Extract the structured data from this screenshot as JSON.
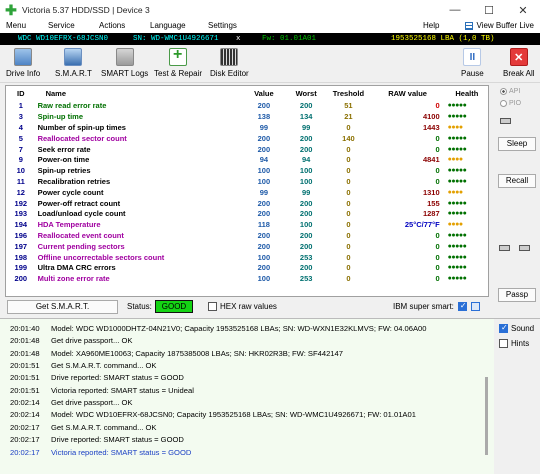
{
  "window": {
    "title": "Victoria 5.37 HDD/SSD | Device 3",
    "minimize": "—",
    "maximize": "☐",
    "close": "✕"
  },
  "menu": {
    "items": [
      "Menu",
      "Service",
      "Actions",
      "Language",
      "Settings"
    ],
    "help": "Help",
    "view_buffer": "View Buffer Live"
  },
  "device_bar": {
    "model": "WDC WD10EFRX-68JCSN0",
    "serial": "SN: WD-WMC1U4926671",
    "close": "x",
    "firmware": "Fw: 01.01A01",
    "capacity": "1953525168 LBA (1,0 TB)",
    "colors": {
      "model": "#00ffff",
      "serial": "#00ffff",
      "firmware": "#00c000",
      "capacity": "#ffff00"
    }
  },
  "toolbar": {
    "drive_info": "Drive Info",
    "smart": "S.M.A.R.T",
    "smart_logs": "SMART Logs",
    "test_repair": "Test & Repair",
    "disk_editor": "Disk Editor",
    "pause": "Pause",
    "break_all": "Break All",
    "pause_glyph": "II",
    "break_glyph": "✕"
  },
  "smart": {
    "headers": [
      "ID",
      "Name",
      "Value",
      "Worst",
      "Treshold",
      "RAW value",
      "Health"
    ],
    "rows": [
      {
        "id": "1",
        "name": "Raw read error rate",
        "value": "200",
        "worst": "200",
        "treshold": "51",
        "raw": "0",
        "health": "●●●●●",
        "name_color": "#007000",
        "health_color": "#007000",
        "raw_color": "#d00000"
      },
      {
        "id": "3",
        "name": "Spin-up time",
        "value": "138",
        "worst": "134",
        "treshold": "21",
        "raw": "4100",
        "health": "●●●●●",
        "name_color": "#007000",
        "health_color": "#007000",
        "raw_color": "#8b0000"
      },
      {
        "id": "4",
        "name": "Number of spin-up times",
        "value": "99",
        "worst": "99",
        "treshold": "0",
        "raw": "1443",
        "health": "●●●●",
        "name_color": "#000000",
        "health_color": "#e3a000",
        "raw_color": "#8b0000"
      },
      {
        "id": "5",
        "name": "Reallocated sector count",
        "value": "200",
        "worst": "200",
        "treshold": "140",
        "raw": "0",
        "health": "●●●●●",
        "name_color": "#a000a0",
        "health_color": "#007000",
        "raw_color": "#007000"
      },
      {
        "id": "7",
        "name": "Seek error rate",
        "value": "200",
        "worst": "200",
        "treshold": "0",
        "raw": "0",
        "health": "●●●●●",
        "name_color": "#000000",
        "health_color": "#007000",
        "raw_color": "#007000"
      },
      {
        "id": "9",
        "name": "Power-on time",
        "value": "94",
        "worst": "94",
        "treshold": "0",
        "raw": "4841",
        "health": "●●●●",
        "name_color": "#000000",
        "health_color": "#e3a000",
        "raw_color": "#8b0000"
      },
      {
        "id": "10",
        "name": "Spin-up retries",
        "value": "100",
        "worst": "100",
        "treshold": "0",
        "raw": "0",
        "health": "●●●●●",
        "name_color": "#000000",
        "health_color": "#007000",
        "raw_color": "#007000"
      },
      {
        "id": "11",
        "name": "Recalibration retries",
        "value": "100",
        "worst": "100",
        "treshold": "0",
        "raw": "0",
        "health": "●●●●●",
        "name_color": "#000000",
        "health_color": "#007000",
        "raw_color": "#007000"
      },
      {
        "id": "12",
        "name": "Power cycle count",
        "value": "99",
        "worst": "99",
        "treshold": "0",
        "raw": "1310",
        "health": "●●●●",
        "name_color": "#000000",
        "health_color": "#e3a000",
        "raw_color": "#8b0000"
      },
      {
        "id": "192",
        "name": "Power-off retract count",
        "value": "200",
        "worst": "200",
        "treshold": "0",
        "raw": "155",
        "health": "●●●●●",
        "name_color": "#000000",
        "health_color": "#007000",
        "raw_color": "#8b0000"
      },
      {
        "id": "193",
        "name": "Load/unload cycle count",
        "value": "200",
        "worst": "200",
        "treshold": "0",
        "raw": "1287",
        "health": "●●●●●",
        "name_color": "#000000",
        "health_color": "#007000",
        "raw_color": "#8b0000"
      },
      {
        "id": "194",
        "name": "HDA Temperature",
        "value": "118",
        "worst": "100",
        "treshold": "0",
        "raw": "25°C/77°F",
        "health": "●●●●",
        "name_color": "#a000a0",
        "health_color": "#e3a000",
        "raw_color": "#0000c0"
      },
      {
        "id": "196",
        "name": "Reallocated event count",
        "value": "200",
        "worst": "200",
        "treshold": "0",
        "raw": "0",
        "health": "●●●●●",
        "name_color": "#a000a0",
        "health_color": "#007000",
        "raw_color": "#007000"
      },
      {
        "id": "197",
        "name": "Current pending sectors",
        "value": "200",
        "worst": "200",
        "treshold": "0",
        "raw": "0",
        "health": "●●●●●",
        "name_color": "#a000a0",
        "health_color": "#007000",
        "raw_color": "#007000"
      },
      {
        "id": "198",
        "name": "Offline uncorrectable sectors count",
        "value": "100",
        "worst": "253",
        "treshold": "0",
        "raw": "0",
        "health": "●●●●●",
        "name_color": "#a000a0",
        "health_color": "#007000",
        "raw_color": "#007000"
      },
      {
        "id": "199",
        "name": "Ultra DMA CRC errors",
        "value": "200",
        "worst": "200",
        "treshold": "0",
        "raw": "0",
        "health": "●●●●●",
        "name_color": "#000000",
        "health_color": "#007000",
        "raw_color": "#007000"
      },
      {
        "id": "200",
        "name": "Multi zone error rate",
        "value": "100",
        "worst": "253",
        "treshold": "0",
        "raw": "0",
        "health": "●●●●●",
        "name_color": "#a000a0",
        "health_color": "#007000",
        "raw_color": "#007000"
      }
    ],
    "colors": {
      "id": "#00008b",
      "value": "#1e5aa8",
      "worst": "#007070",
      "treshold": "#8b7000"
    }
  },
  "status_strip": {
    "get_smart": "Get S.M.A.R.T.",
    "status_label": "Status:",
    "status_value": "GOOD",
    "hex_label": "HEX raw values",
    "ibm_label": "IBM super smart:"
  },
  "right_panel": {
    "api": "API",
    "pio": "PIO",
    "sleep": "Sleep",
    "recall": "Recall",
    "passp": "Passp"
  },
  "log": [
    {
      "time": "20:01:40",
      "text": "Model: WDC WD1000DHTZ-04N21V0; Capacity 1953525168 LBAs; SN: WD-WXN1E32KLMVS; FW: 04.06A00",
      "color": "#000000"
    },
    {
      "time": "20:01:48",
      "text": "Get drive passport... OK",
      "color": "#000000"
    },
    {
      "time": "20:01:48",
      "text": "Model: XA960ME10063; Capacity 1875385008 LBAs; SN: HKR02R3B; FW: SF442147",
      "color": "#000000"
    },
    {
      "time": "20:01:51",
      "text": "Get S.M.A.R.T. command... OK",
      "color": "#000000"
    },
    {
      "time": "20:01:51",
      "text": "Drive reported: SMART status = GOOD",
      "color": "#000000"
    },
    {
      "time": "20:01:51",
      "text": "Victoria reported: SMART status = Unideal",
      "color": "#000000"
    },
    {
      "time": "20:02:14",
      "text": "Get drive passport... OK",
      "color": "#000000"
    },
    {
      "time": "20:02:14",
      "text": "Model: WDC WD10EFRX-68JCSN0; Capacity 1953525168 LBAs; SN: WD-WMC1U4926671; FW: 01.01A01",
      "color": "#000000"
    },
    {
      "time": "20:02:17",
      "text": "Get S.M.A.R.T. command... OK",
      "color": "#000000"
    },
    {
      "time": "20:02:17",
      "text": "Drive reported: SMART status = GOOD",
      "color": "#000000"
    },
    {
      "time": "20:02:17",
      "text": "Victoria reported: SMART status = GOOD",
      "color": "#1a3fc4"
    }
  ],
  "sound_panel": {
    "sound": "Sound",
    "hints": "Hints"
  }
}
